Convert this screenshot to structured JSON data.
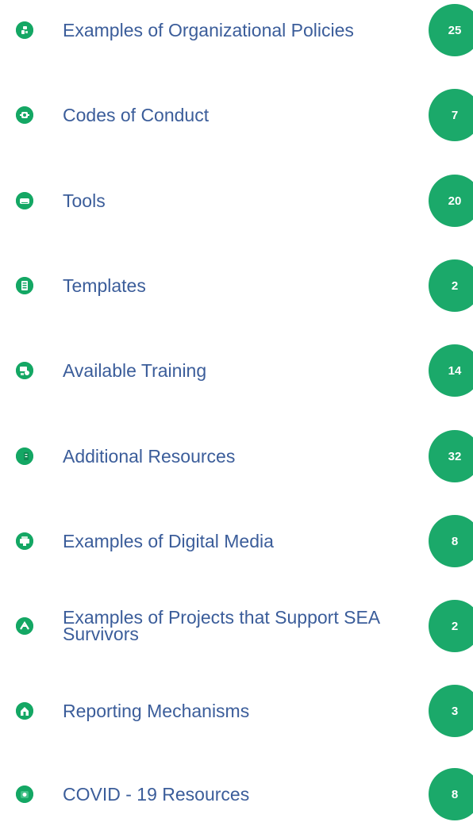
{
  "accent_color": "#1ba96a",
  "link_color": "#3b5d9a",
  "categories": [
    {
      "label": "Examples of Organizational Policies",
      "count": "25",
      "icon": "policy-icon"
    },
    {
      "label": "Codes of Conduct",
      "count": "7",
      "icon": "code-of-conduct-icon"
    },
    {
      "label": "Tools",
      "count": "20",
      "icon": "tools-icon"
    },
    {
      "label": "Templates",
      "count": "2",
      "icon": "template-icon"
    },
    {
      "label": "Available Training",
      "count": "14",
      "icon": "training-icon"
    },
    {
      "label": "Additional Resources",
      "count": "32",
      "icon": "resources-icon"
    },
    {
      "label": "Examples of Digital Media",
      "count": "8",
      "icon": "digital-media-icon"
    },
    {
      "label": "Examples of Projects that Support SEA Survivors",
      "count": "2",
      "icon": "projects-icon"
    },
    {
      "label": "Reporting Mechanisms",
      "count": "3",
      "icon": "reporting-icon"
    },
    {
      "label": "COVID - 19 Resources",
      "count": "8",
      "icon": "covid-icon"
    }
  ]
}
